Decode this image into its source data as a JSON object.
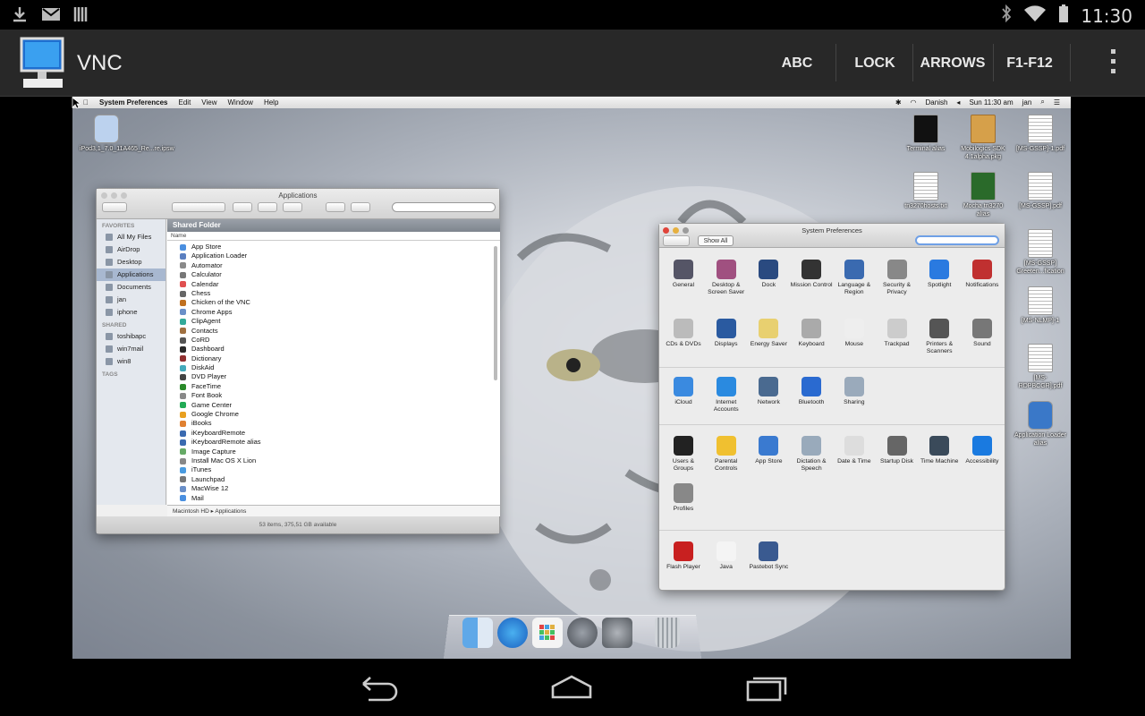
{
  "status_bar": {
    "time": "11:30"
  },
  "app_bar": {
    "title": "VNC",
    "buttons": [
      "ABC",
      "LOCK",
      "ARROWS",
      "F1-F12"
    ]
  },
  "mac_menubar": {
    "app": "System Preferences",
    "items": [
      "Edit",
      "View",
      "Window",
      "Help"
    ],
    "right": [
      "Danish",
      "Sun 11:30 am",
      "jan"
    ]
  },
  "desktop_icons": [
    {
      "label": "iPod3,1_7.0_11A465_Re...re.ipsw"
    },
    {
      "label": "Terminal alias"
    },
    {
      "label": "Mobilogics SDK 4.1alpha.pkg"
    },
    {
      "label": "[MS-GSSP]-1.pdf"
    },
    {
      "label": "tn3270hosts.txt"
    },
    {
      "label": "Mocha tn3270 alias"
    },
    {
      "label": "[MS-GSSP].pdf"
    },
    {
      "label": "[MS-GSSP] Greeten...fication"
    },
    {
      "label": "[MS-NLMP]-1"
    },
    {
      "label": "[MS-RDPBCGR].pdf"
    },
    {
      "label": "Application Loader alias"
    }
  ],
  "finder": {
    "title": "Applications",
    "sidebar": {
      "favorites_header": "FAVORITES",
      "favorites": [
        "All My Files",
        "AirDrop",
        "Desktop",
        "Applications",
        "Documents",
        "jan",
        "iphone"
      ],
      "shared_header": "SHARED",
      "shared": [
        "toshibapc",
        "win7mail",
        "win8"
      ],
      "tags_header": "TAGS"
    },
    "shared_folder": "Shared Folder",
    "column": "Name",
    "items": [
      "App Store",
      "Application Loader",
      "Automator",
      "Calculator",
      "Calendar",
      "Chess",
      "Chicken of the VNC",
      "Chrome Apps",
      "ClipAgent",
      "Contacts",
      "CoRD",
      "Dashboard",
      "Dictionary",
      "DiskAid",
      "DVD Player",
      "FaceTime",
      "Font Book",
      "Game Center",
      "Google Chrome",
      "iBooks",
      "iKeyboardRemote",
      "iKeyboardRemote alias",
      "Image Capture",
      "Install Mac OS X Lion",
      "iTunes",
      "Launchpad",
      "MacWise 12",
      "Mail"
    ],
    "path": [
      "Macintosh HD",
      "Applications"
    ],
    "status": "53 items, 375,51 GB available"
  },
  "sysprefs": {
    "title": "System Preferences",
    "show_all": "Show All",
    "row1": [
      "General",
      "Desktop & Screen Saver",
      "Dock",
      "Mission Control",
      "Language & Region",
      "Security & Privacy",
      "Spotlight",
      "Notifications"
    ],
    "row2": [
      "CDs & DVDs",
      "Displays",
      "Energy Saver",
      "Keyboard",
      "Mouse",
      "Trackpad",
      "Printers & Scanners",
      "Sound"
    ],
    "row3": [
      "iCloud",
      "Internet Accounts",
      "Network",
      "Bluetooth",
      "Sharing"
    ],
    "row4": [
      "Users & Groups",
      "Parental Controls",
      "App Store",
      "Dictation & Speech",
      "Date & Time",
      "Startup Disk",
      "Time Machine",
      "Accessibility"
    ],
    "row5": [
      "Profiles"
    ],
    "row6": [
      "Flash Player",
      "Java",
      "Pastebot Sync"
    ]
  }
}
